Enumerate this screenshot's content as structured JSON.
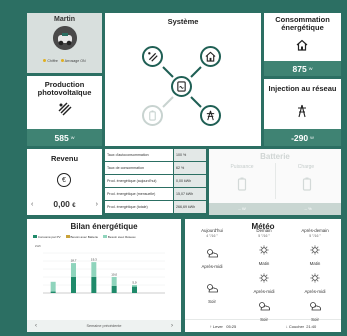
{
  "martin": {
    "name": "Martin",
    "status1": "Chiffre",
    "status2": "Arrosage ON"
  },
  "prod": {
    "title_line1": "Production",
    "title_line2": "photovoltaïque",
    "value": "585",
    "unit": "W"
  },
  "system": {
    "title": "Système"
  },
  "consommation": {
    "title_line1": "Consommation",
    "title_line2": "énergétique",
    "value": "875",
    "unit": "W"
  },
  "injection": {
    "title": "Injection au réseau",
    "value": "-290",
    "unit": "W"
  },
  "revenu": {
    "title": "Revenu",
    "value": "0,00",
    "currency": "€"
  },
  "stats": [
    {
      "label": "Taux d'autoconsommation",
      "value": "100 %"
    },
    {
      "label": "Taux de consommation",
      "value": "62 %"
    },
    {
      "label": "Prod. énergétique (aujourd'hui)",
      "value": "0,00 kWh"
    },
    {
      "label": "Prod. énergétique (mensuelle)",
      "value": "15,07 kWh"
    },
    {
      "label": "Prod. énergétique (totale)",
      "value": "266,69 kWh"
    }
  ],
  "batterie": {
    "title": "Batterie",
    "col1": "Puissance",
    "col2": "Charge",
    "val1": "-- W",
    "val2": "-- %"
  },
  "bilan": {
    "title": "Bilan énergétique",
    "legend": [
      "Consomé par PV",
      "Besoin avec Batterie",
      "Besoin avec Réseau"
    ],
    "ylabel": "kWh",
    "week_label": "Semaine précédente"
  },
  "chart_data": {
    "type": "bar",
    "title": "Bilan énergétique",
    "ylabel": "kWh",
    "series": [
      {
        "name": "Consomé par PV",
        "color": "#1f8a6a",
        "values": [
          0.9,
          10.1,
          10.1,
          4.5,
          4.0
        ]
      },
      {
        "name": "Besoin avec Réseau",
        "color": "#8fd4bc",
        "values": [
          6.1,
          8.6,
          9.2,
          5.5,
          1.0
        ]
      }
    ],
    "labels": [
      "",
      "18,7",
      "19,3",
      "10,0",
      "5,0"
    ],
    "ylim": [
      -5,
      25
    ],
    "categories": [
      "",
      "",
      "",
      "",
      ""
    ]
  },
  "meteo": {
    "title": "Météo",
    "columns": [
      {
        "day": "Aujourd'hui",
        "temp": "4 °/16 °",
        "periods": [
          "Après-midi",
          "Soir"
        ]
      },
      {
        "day": "Demain",
        "temp": "5 °/16 °",
        "periods": [
          "Matin",
          "Après-midi",
          "Soir"
        ]
      },
      {
        "day": "Après-demain",
        "temp": "5 °/16 °",
        "periods": [
          "Matin",
          "Après-midi",
          "Soir"
        ]
      }
    ],
    "lever_label": "Lever",
    "lever_time": "05:25",
    "coucher_label": "Coucher",
    "coucher_time": "21:40"
  },
  "colors": {
    "background": "#2c6f63",
    "footer": "#3f8373",
    "accent": "#1f5f54"
  }
}
